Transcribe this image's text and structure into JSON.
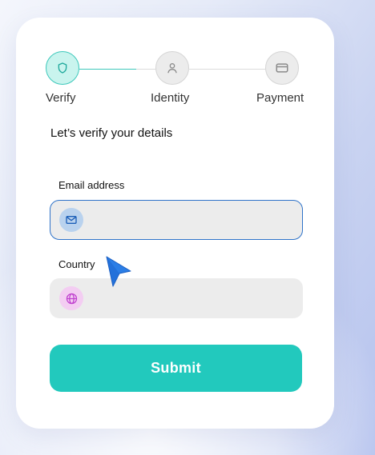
{
  "stepper": {
    "steps": [
      {
        "label": "Verify",
        "icon": "shield-icon",
        "state": "active"
      },
      {
        "label": "Identity",
        "icon": "user-icon",
        "state": "inactive"
      },
      {
        "label": "Payment",
        "icon": "card-icon",
        "state": "inactive"
      }
    ]
  },
  "form": {
    "heading": "Let’s verify your details",
    "email": {
      "label": "Email address",
      "value": "",
      "placeholder": "",
      "icon": "mail-icon"
    },
    "country": {
      "label": "Country",
      "value": "",
      "placeholder": "",
      "icon": "globe-icon"
    },
    "submit_label": "Submit"
  },
  "colors": {
    "accent": "#22c9bd",
    "focus_border": "#2f73c9",
    "active_step_fill": "#c9f4ee"
  }
}
